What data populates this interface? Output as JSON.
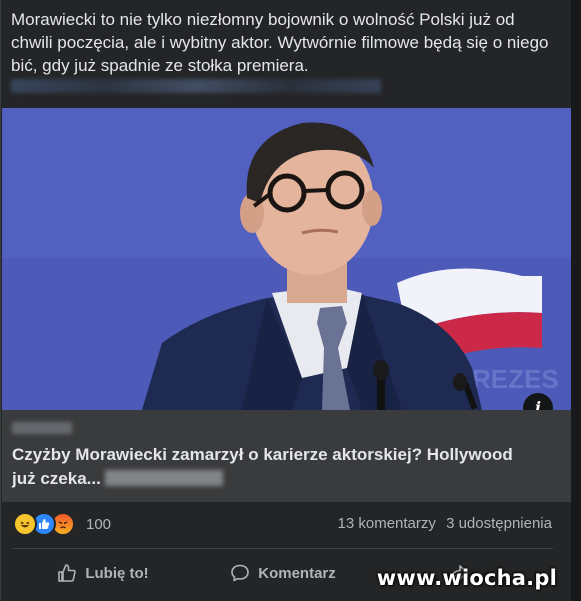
{
  "post": {
    "text": "Morawiecki to nie tylko niezłomny bojownik o wolność Polski już od chwili poczęcia, ale i wybitny aktor. Wytwórnie filmowe będą się o niego bić, gdy już spadnie ze stołka premiera."
  },
  "link_card": {
    "title": "Czyżby Morawiecki zamarzył o karierze aktorskiej? Hollywood już czeka..."
  },
  "reactions": {
    "icons": [
      "haha-icon",
      "like-icon",
      "angry-icon"
    ],
    "count": "100"
  },
  "stats": {
    "comments": "13 komentarzy",
    "shares": "3 udostępnienia"
  },
  "actions": {
    "like": "Lubię to!",
    "comment": "Komentarz"
  },
  "watermark": "www.wiocha.pl",
  "colors": {
    "background": "#242526",
    "card": "#3a3b3c",
    "text": "#e4e6eb",
    "secondary_text": "#b0b3b8",
    "like_blue": "#2d88ff"
  }
}
